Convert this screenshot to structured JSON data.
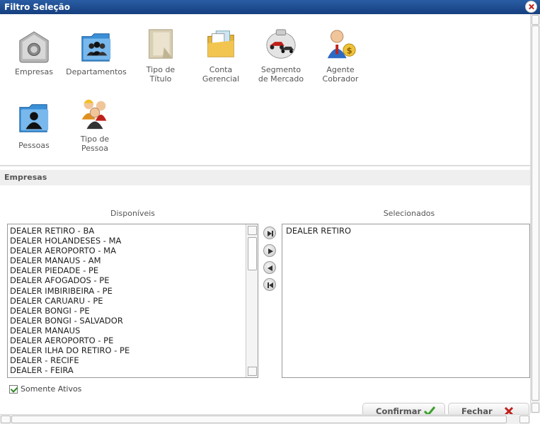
{
  "window": {
    "title": "Filtro Seleção"
  },
  "categories": [
    {
      "label": "Empresas",
      "icon": "safe-icon"
    },
    {
      "label": "Departamentos",
      "icon": "people-folder-icon"
    },
    {
      "label": "Tipo de\nTítulo",
      "icon": "document-icon"
    },
    {
      "label": "Conta\nGerencial",
      "icon": "folder-notes-icon"
    },
    {
      "label": "Segmento\nde Mercado",
      "icon": "cars-icon"
    },
    {
      "label": "Agente\nCobrador",
      "icon": "collector-icon"
    },
    {
      "label": "Pessoas",
      "icon": "person-folder-icon"
    },
    {
      "label": "Tipo de\nPessoa",
      "icon": "workers-icon"
    }
  ],
  "section": {
    "title": "Empresas"
  },
  "available": {
    "header": "Disponíveis",
    "items": [
      "DEALER RETIRO - BA",
      "DEALER HOLANDESES - MA",
      "DEALER AEROPORTO - MA",
      "DEALER MANAUS - AM",
      "DEALER PIEDADE - PE",
      "DEALER AFOGADOS - PE",
      "DEALER IMBIRIBEIRA - PE",
      "DEALER CARUARU - PE",
      "DEALER BONGI - PE",
      "DEALER BONGI - SALVADOR",
      "DEALER MANAUS",
      "DEALER AEROPORTO - PE",
      "DEALER ILHA DO RETIRO - PE",
      "DEALER - RECIFE",
      "DEALER - FEIRA"
    ]
  },
  "selected": {
    "header": "Selecionados",
    "items": [
      "DEALER RETIRO"
    ]
  },
  "options": {
    "only_active": "Somente Ativos",
    "only_active_checked": true
  },
  "footer": {
    "confirm": "Confirmar",
    "close": "Fechar"
  },
  "colors": {
    "titlebar": "#1f4f95",
    "check": "#2a8a1e",
    "close": "#c0201a"
  }
}
